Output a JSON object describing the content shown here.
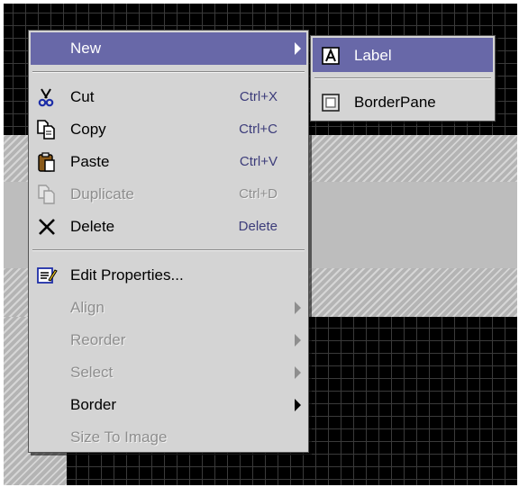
{
  "context_menu": {
    "items": [
      {
        "label": "New",
        "icon": "new-icon",
        "highlighted": true,
        "has_submenu": true
      },
      {
        "label": "Cut",
        "shortcut": "Ctrl+X",
        "icon": "scissors-icon"
      },
      {
        "label": "Copy",
        "shortcut": "Ctrl+C",
        "icon": "copy-icon"
      },
      {
        "label": "Paste",
        "shortcut": "Ctrl+V",
        "icon": "clipboard-icon"
      },
      {
        "label": "Duplicate",
        "shortcut": "Ctrl+D",
        "icon": "duplicate-icon",
        "disabled": true
      },
      {
        "label": "Delete",
        "shortcut": "Delete",
        "icon": "x-icon"
      },
      {
        "label": "Edit Properties...",
        "icon": "edit-properties-icon"
      },
      {
        "label": "Align",
        "disabled": true,
        "has_submenu": true
      },
      {
        "label": "Reorder",
        "disabled": true,
        "has_submenu": true
      },
      {
        "label": "Select",
        "disabled": true,
        "has_submenu": true
      },
      {
        "label": "Border",
        "has_submenu": true
      },
      {
        "label": "Size To Image",
        "disabled": true
      }
    ]
  },
  "submenu": {
    "items": [
      {
        "label": "Label",
        "icon": "label-a-icon",
        "highlighted": true
      },
      {
        "label": "BorderPane",
        "icon": "border-pane-icon"
      }
    ]
  },
  "colors": {
    "highlight": "#6868a8",
    "menu_bg": "#d4d4d4",
    "disabled_text": "#8e8e8e",
    "shortcut_text": "#3c3c7a",
    "canvas_bg": "#000000"
  }
}
